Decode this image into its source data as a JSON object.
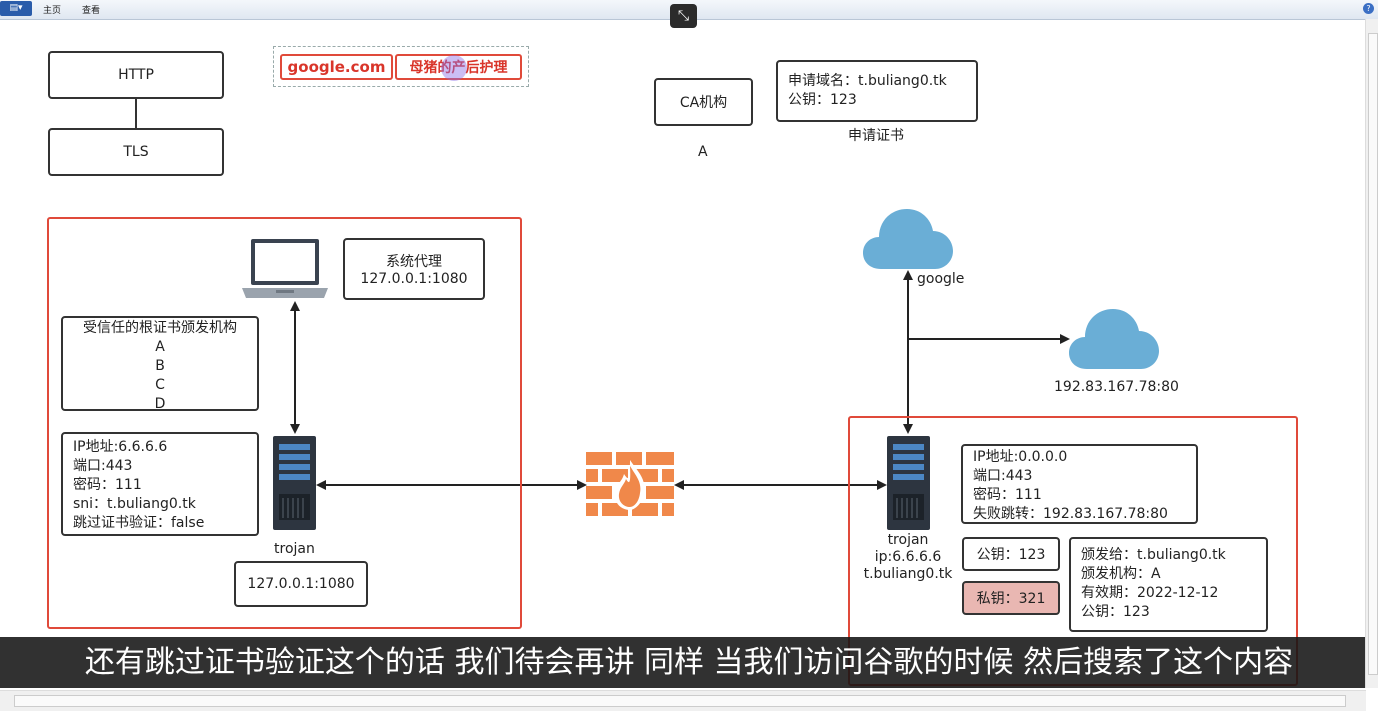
{
  "ribbon": {
    "file_menu": "▤▾",
    "tab_home": "主页",
    "tab_view": "查看",
    "help": "?"
  },
  "canvas_toggle": "⤡",
  "top_left": {
    "http": "HTTP",
    "tls": "TLS"
  },
  "banner": {
    "left": "google.com",
    "right": "母猪的产后护理"
  },
  "ca": {
    "title": "CA机构",
    "label": "A"
  },
  "cert_request": {
    "line1": "申请域名：t.buliang0.tk",
    "line2": "公钥：123",
    "caption": "申请证书"
  },
  "client": {
    "proxy": {
      "title": "系统代理",
      "addr": "127.0.0.1:1080"
    },
    "trusted_roots": {
      "title": "受信任的根证书颁发机构",
      "items": [
        "A",
        "B",
        "C",
        "D"
      ]
    },
    "config": {
      "ip": "IP地址:6.6.6.6",
      "port": "端口:443",
      "password": "密码：111",
      "sni": "sni：t.buliang0.tk",
      "skip": "跳过证书验证：false"
    },
    "server_label": "trojan",
    "local_addr": "127.0.0.1:1080"
  },
  "internet": {
    "google_label": "google",
    "fallback_cloud_label": "192.83.167.78:80"
  },
  "server": {
    "config": {
      "ip": "IP地址:0.0.0.0",
      "port": "端口:443",
      "password": "密码：111",
      "fallback": "失败跳转：192.83.167.78:80"
    },
    "label_name": "trojan",
    "label_ip": "ip:6.6.6.6",
    "label_domain": "t.buliang0.tk",
    "public_key": "公钥：123",
    "private_key": "私钥：321",
    "cert": {
      "issued_to": "颁发给：t.buliang0.tk",
      "issuer": "颁发机构：A",
      "expiry": "有效期：2022-12-12",
      "pubkey": "公钥：123"
    }
  },
  "subtitle": "还有跳过证书验证这个的话 我们待会再讲 同样 当我们访问谷歌的时候 然后搜索了这个内容",
  "colors": {
    "red_frame": "#e04a3a",
    "cloud": "#6aaed6",
    "firewall": "#f0884a",
    "private_key_bg": "#e9b7b2"
  }
}
